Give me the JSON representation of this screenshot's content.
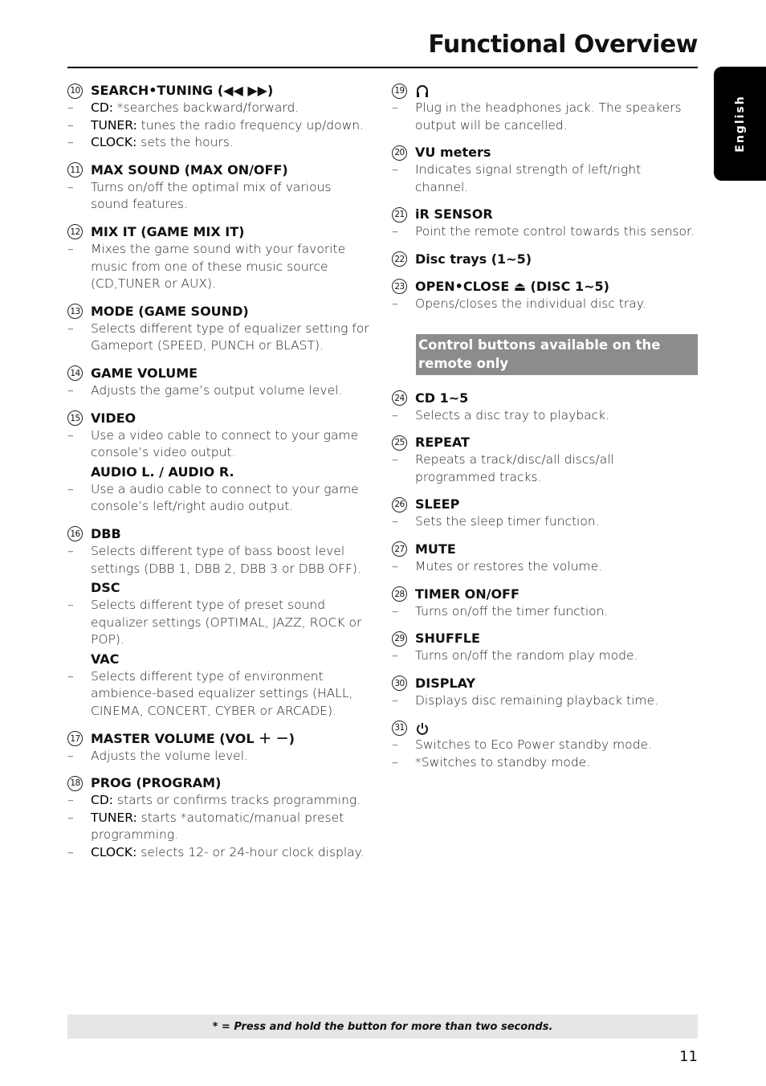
{
  "page": {
    "title": "Functional Overview",
    "language_tab": "English",
    "footer_note": "* = Press and hold the button for more than two seconds.",
    "page_number": "11"
  },
  "left": [
    {
      "num": "10",
      "title": "SEARCH•TUNING (◀◀ ▶▶)",
      "lines": [
        {
          "key": "CD:",
          "text": " *searches backward/forward."
        },
        {
          "key": "TUNER:",
          "text": " tunes the radio frequency up/down."
        },
        {
          "key": "CLOCK:",
          "text": " sets the hours."
        }
      ]
    },
    {
      "num": "11",
      "title": "MAX SOUND (MAX ON/OFF)",
      "lines": [
        {
          "key": "",
          "text": "Turns on/off the optimal mix of various sound features."
        }
      ]
    },
    {
      "num": "12",
      "title": "MIX IT (GAME MIX IT)",
      "lines": [
        {
          "key": "",
          "text": "Mixes the game sound with your favorite music from one of these music source (CD,TUNER or AUX)."
        }
      ]
    },
    {
      "num": "13",
      "title": "MODE (GAME SOUND)",
      "lines": [
        {
          "key": "",
          "text": "Selects different type of equalizer setting for Gameport (SPEED, PUNCH or BLAST)."
        }
      ]
    },
    {
      "num": "14",
      "title": "GAME VOLUME",
      "lines": [
        {
          "key": "",
          "text": "Adjusts the game’s output volume level."
        }
      ]
    },
    {
      "num": "15",
      "title": "VIDEO",
      "lines": [
        {
          "key": "",
          "text": "Use a video cable to connect to your game console’s video output."
        }
      ],
      "sub": {
        "title": "AUDIO L. / AUDIO R.",
        "lines": [
          {
            "key": "",
            "text": "Use a audio cable to connect to your game console’s left/right audio output."
          }
        ]
      }
    },
    {
      "num": "16",
      "title": "DBB",
      "lines": [
        {
          "key": "",
          "text": "Selects different type of bass boost level settings (DBB 1, DBB 2, DBB 3 or DBB OFF)."
        }
      ],
      "sub": {
        "title": "DSC",
        "lines": [
          {
            "key": "",
            "text": "Selects different type of preset sound equalizer settings (OPTIMAL, JAZZ, ROCK or POP)."
          }
        ]
      },
      "sub2": {
        "title": "VAC",
        "lines": [
          {
            "key": "",
            "text": "Selects different type of environment ambience-based equalizer settings (HALL, CINEMA, CONCERT, CYBER or ARCADE)."
          }
        ]
      }
    },
    {
      "num": "17",
      "title": "MASTER VOLUME (VOL ＋ －)",
      "lines": [
        {
          "key": "",
          "text": "Adjusts the volume level."
        }
      ]
    },
    {
      "num": "18",
      "title": "PROG (PROGRAM)",
      "lines": [
        {
          "key": "CD:",
          "text": " starts or confirms tracks programming."
        },
        {
          "key": "TUNER:",
          "text": " starts *automatic/manual preset programming."
        },
        {
          "key": "CLOCK:",
          "text": " selects 12- or 24-hour clock display."
        }
      ]
    }
  ],
  "right": [
    {
      "num": "19",
      "title": "",
      "icon": "headphones-icon",
      "lines": [
        {
          "key": "",
          "text": "Plug in the headphones jack. The speakers output will be cancelled."
        }
      ]
    },
    {
      "num": "20",
      "title": "VU meters",
      "lines": [
        {
          "key": "",
          "text": "Indicates signal strength of left/right channel."
        }
      ]
    },
    {
      "num": "21",
      "title": "iR SENSOR",
      "lines": [
        {
          "key": "",
          "text": "Point the remote control towards this sensor."
        }
      ]
    },
    {
      "num": "22",
      "title": "Disc trays (1~5)",
      "lines": []
    },
    {
      "num": "23",
      "title": "OPEN•CLOSE ⏏ (DISC 1~5)",
      "lines": [
        {
          "key": "",
          "text": "Opens/closes the individual disc tray."
        }
      ]
    }
  ],
  "remote_banner": "Control buttons available on the remote only",
  "right2": [
    {
      "num": "24",
      "title": "CD 1~5",
      "lines": [
        {
          "key": "",
          "text": "Selects a disc tray to playback."
        }
      ]
    },
    {
      "num": "25",
      "title": "REPEAT",
      "lines": [
        {
          "key": "",
          "text": "Repeats a track/disc/all discs/all programmed tracks."
        }
      ]
    },
    {
      "num": "26",
      "title": "SLEEP",
      "lines": [
        {
          "key": "",
          "text": "Sets the sleep timer function."
        }
      ]
    },
    {
      "num": "27",
      "title": "MUTE",
      "lines": [
        {
          "key": "",
          "text": "Mutes or restores the volume."
        }
      ]
    },
    {
      "num": "28",
      "title": "TIMER ON/OFF",
      "lines": [
        {
          "key": "",
          "text": "Turns on/off the timer function."
        }
      ]
    },
    {
      "num": "29",
      "title": "SHUFFLE",
      "lines": [
        {
          "key": "",
          "text": "Turns on/off the random play mode."
        }
      ]
    },
    {
      "num": "30",
      "title": "DISPLAY",
      "lines": [
        {
          "key": "",
          "text": "Displays disc remaining playback time."
        }
      ]
    },
    {
      "num": "31",
      "title": "",
      "icon": "power-icon",
      "lines": [
        {
          "key": "",
          "text": "Switches to Eco Power standby mode."
        },
        {
          "key": "",
          "text": "*Switches to standby mode."
        }
      ]
    }
  ]
}
